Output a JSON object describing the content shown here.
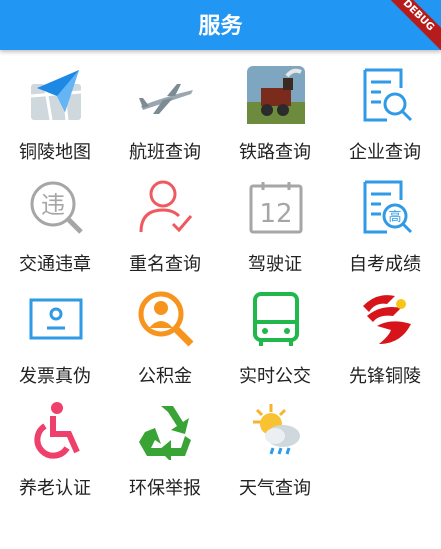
{
  "appbar": {
    "title": "服务",
    "debug_banner": "DEBUG"
  },
  "services": [
    {
      "label": "铜陵地图",
      "icon": "map-navigation-icon"
    },
    {
      "label": "航班查询",
      "icon": "airplane-icon"
    },
    {
      "label": "铁路查询",
      "icon": "steam-train-icon"
    },
    {
      "label": "企业查询",
      "icon": "enterprise-search-icon"
    },
    {
      "label": "交通违章",
      "icon": "traffic-violation-icon"
    },
    {
      "label": "重名查询",
      "icon": "duplicate-name-check-icon"
    },
    {
      "label": "驾驶证",
      "icon": "driver-license-icon"
    },
    {
      "label": "自考成绩",
      "icon": "exam-score-search-icon"
    },
    {
      "label": "发票真伪",
      "icon": "invoice-verify-icon"
    },
    {
      "label": "公积金",
      "icon": "housing-fund-icon"
    },
    {
      "label": "实时公交",
      "icon": "bus-icon"
    },
    {
      "label": "先锋铜陵",
      "icon": "party-emblem-icon"
    },
    {
      "label": "养老认证",
      "icon": "wheelchair-icon"
    },
    {
      "label": "环保举报",
      "icon": "recycle-icon"
    },
    {
      "label": "天气查询",
      "icon": "weather-icon"
    }
  ],
  "icon_texts": {
    "traffic": "违",
    "license": "12",
    "exam": "高"
  },
  "colors": {
    "appbar": "#2196f3",
    "blue": "#2f9ae6",
    "gray": "#a6a6a6",
    "red": "#f0595f",
    "orange": "#f7941d",
    "green": "#20b84a",
    "pink": "#ef3f6b"
  }
}
